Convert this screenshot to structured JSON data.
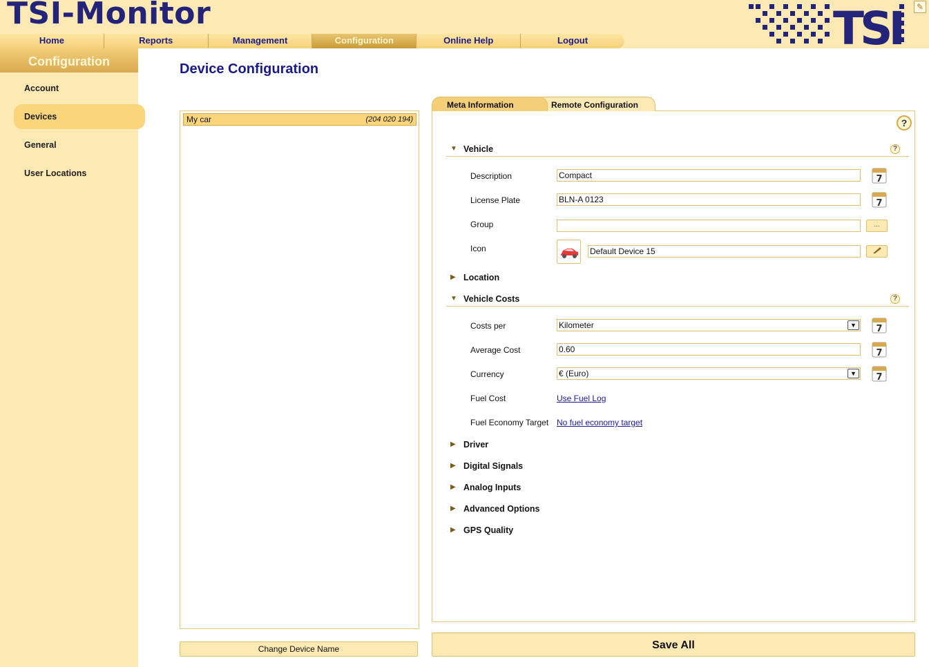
{
  "app": {
    "title": "TSI-Monitor",
    "logo_text": "TSI"
  },
  "nav": {
    "items": [
      {
        "label": "Home"
      },
      {
        "label": "Reports"
      },
      {
        "label": "Management"
      },
      {
        "label": "Configuration"
      },
      {
        "label": "Online Help"
      },
      {
        "label": "Logout"
      }
    ],
    "active": "Configuration"
  },
  "sidebar": {
    "title": "Configuration",
    "items": [
      {
        "label": "Account"
      },
      {
        "label": "Devices"
      },
      {
        "label": "General"
      },
      {
        "label": "User Locations"
      }
    ],
    "active": "Devices"
  },
  "page": {
    "title": "Device Configuration"
  },
  "devices": {
    "rows": [
      {
        "name": "My car",
        "id": "(204 020 194)"
      }
    ],
    "change_name_label": "Change Device Name"
  },
  "tabs": [
    {
      "label": "Meta Information"
    },
    {
      "label": "Remote Configuration"
    }
  ],
  "vehicle": {
    "section_label": "Vehicle",
    "description_label": "Description",
    "description_value": "Compact",
    "license_label": "License Plate",
    "license_value": "BLN-A 0123",
    "group_label": "Group",
    "group_value": "",
    "group_button": "...",
    "icon_label": "Icon",
    "icon_value": "Default Device 15"
  },
  "sections": {
    "location": "Location",
    "vehicle_costs": "Vehicle Costs",
    "driver": "Driver",
    "digital_signals": "Digital Signals",
    "analog_inputs": "Analog Inputs",
    "advanced_options": "Advanced Options",
    "gps_quality": "GPS Quality"
  },
  "costs": {
    "costs_per_label": "Costs per",
    "costs_per_value": "Kilometer",
    "average_cost_label": "Average Cost",
    "average_cost_value": "0.60",
    "currency_label": "Currency",
    "currency_value": "€ (Euro)",
    "fuel_cost_label": "Fuel Cost",
    "fuel_cost_link": "Use Fuel Log",
    "fuel_economy_label": "Fuel Economy Target",
    "fuel_economy_link": "No fuel economy target"
  },
  "help_glyph": "?",
  "save_all_label": "Save All",
  "colors": {
    "accent": "#1a1a8a",
    "sidebar_bg": "#fde9b3",
    "highlight": "#fbd57c",
    "border": "#e2c06e"
  }
}
